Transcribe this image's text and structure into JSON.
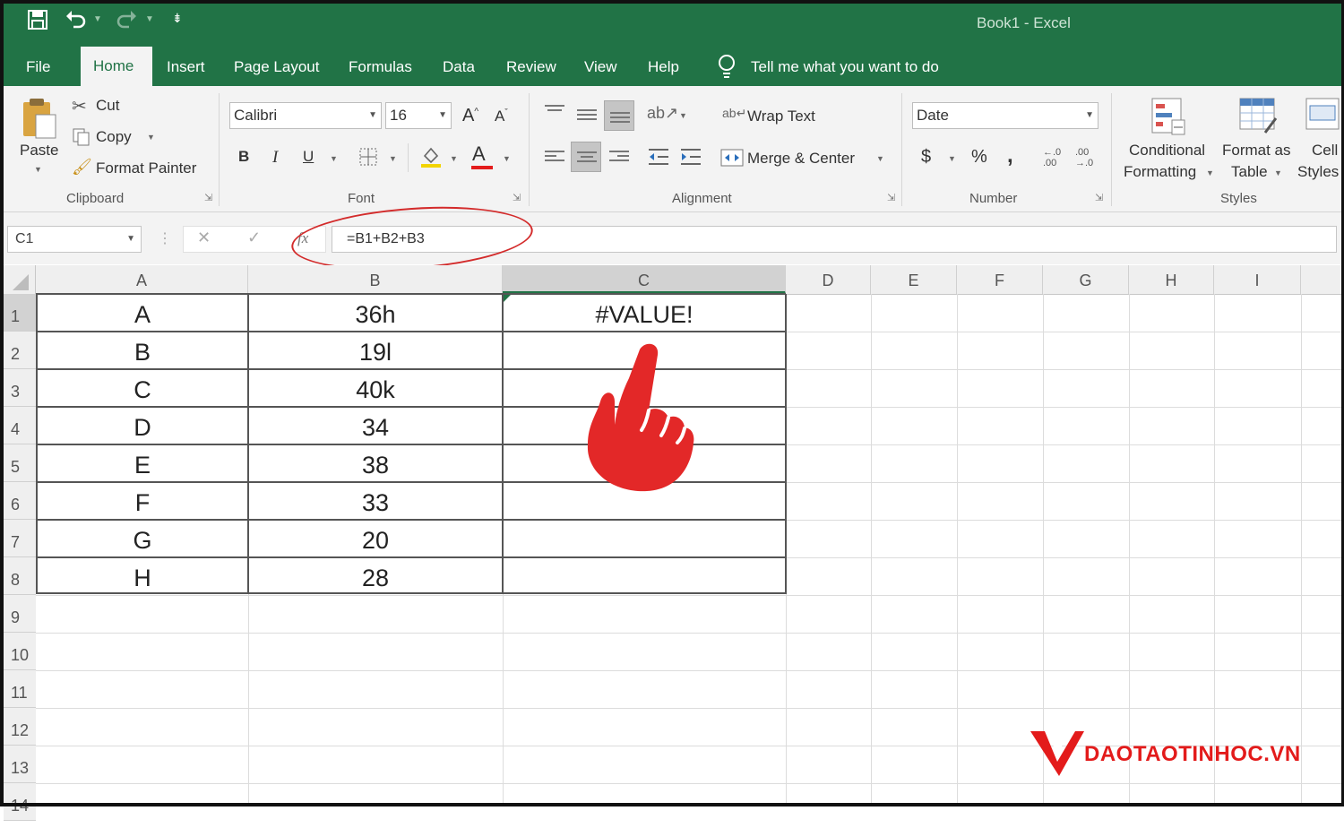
{
  "window": {
    "title": "Book1  -  Excel"
  },
  "quick_access": {
    "save_icon": "save-icon",
    "undo_icon": "undo-icon",
    "redo_icon": "redo-icon",
    "customize_icon": "customize-icon"
  },
  "tabs": [
    {
      "label": "File"
    },
    {
      "label": "Home"
    },
    {
      "label": "Insert"
    },
    {
      "label": "Page Layout"
    },
    {
      "label": "Formulas"
    },
    {
      "label": "Data"
    },
    {
      "label": "Review"
    },
    {
      "label": "View"
    },
    {
      "label": "Help"
    }
  ],
  "tell_me": "Tell me what you want to do",
  "ribbon": {
    "clipboard": {
      "paste": "Paste",
      "cut": "Cut",
      "copy": "Copy",
      "format_painter": "Format Painter",
      "label": "Clipboard"
    },
    "font": {
      "family": "Calibri",
      "size": "16",
      "grow": "A",
      "shrink": "A",
      "bold": "B",
      "italic": "I",
      "underline": "U",
      "font_color": "A",
      "label": "Font"
    },
    "alignment": {
      "wrap_text": "Wrap Text",
      "merge_center": "Merge & Center",
      "label": "Alignment"
    },
    "number": {
      "format": "Date",
      "currency": "$",
      "percent": "%",
      "comma": ",",
      "label": "Number"
    },
    "styles": {
      "conditional_1": "Conditional",
      "conditional_2": "Formatting",
      "format_table_1": "Format as",
      "format_table_2": "Table",
      "cell_styles_1": "Cell",
      "cell_styles_2": "Styles",
      "label": "Styles"
    }
  },
  "formula_bar": {
    "name_box": "C1",
    "cancel": "✕",
    "enter": "✓",
    "fx": "fx",
    "formula": "=B1+B2+B3"
  },
  "columns": [
    "A",
    "B",
    "C",
    "D",
    "E",
    "F",
    "G",
    "H",
    "I"
  ],
  "rows": [
    "1",
    "2",
    "3",
    "4",
    "5",
    "6",
    "7",
    "8",
    "9",
    "10",
    "11",
    "12",
    "13",
    "14"
  ],
  "cells": {
    "A": [
      "A",
      "B",
      "C",
      "D",
      "E",
      "F",
      "G",
      "H"
    ],
    "B": [
      "36h",
      "19l",
      "40k",
      "34",
      "38",
      "33",
      "20",
      "28"
    ],
    "C1": "#VALUE!"
  },
  "annotation": {
    "pointer_icon": "pointing-hand-icon",
    "highlight_color": "#d32b2b"
  },
  "watermark": {
    "text": "DAOTAOTINHOC.VN",
    "color": "#e31b1b"
  },
  "theme": {
    "excel_green": "#217346"
  }
}
